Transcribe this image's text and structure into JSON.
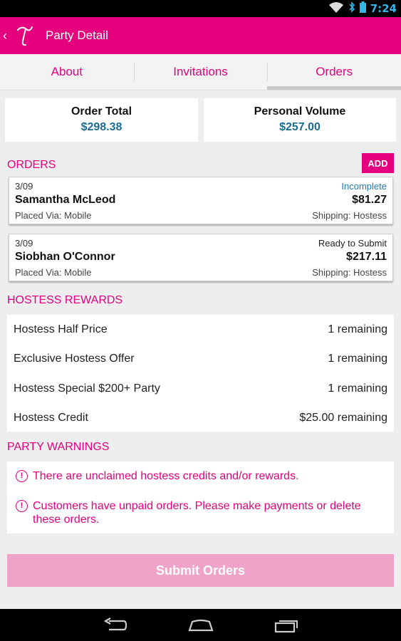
{
  "status_bar": {
    "time": "7:24",
    "icons": [
      "wifi-icon",
      "bluetooth-icon",
      "battery-icon"
    ]
  },
  "action_bar": {
    "title": "Party Detail",
    "back_icon": "chevron-left-icon",
    "logo_icon": "app-logo-icon"
  },
  "tabs": [
    {
      "label": "About",
      "active": false
    },
    {
      "label": "Invitations",
      "active": false
    },
    {
      "label": "Orders",
      "active": true
    }
  ],
  "summary": {
    "order_total_label": "Order Total",
    "order_total_value": "$298.38",
    "personal_volume_label": "Personal Volume",
    "personal_volume_value": "$257.00"
  },
  "orders": {
    "section_title": "ORDERS",
    "add_label": "ADD",
    "items": [
      {
        "date": "3/09",
        "status": "Incomplete",
        "status_color": "#1a7cb0",
        "name": "Samantha McLeod",
        "amount": "$81.27",
        "placed_via": "Placed Via: Mobile",
        "shipping": "Shipping: Hostess"
      },
      {
        "date": "3/09",
        "status": "Ready to Submit",
        "status_color": "#222222",
        "name": "Siobhan O'Connor",
        "amount": "$217.11",
        "placed_via": "Placed Via: Mobile",
        "shipping": "Shipping: Hostess"
      }
    ]
  },
  "hostess_rewards": {
    "section_title": "HOSTESS REWARDS",
    "items": [
      {
        "label": "Hostess Half Price",
        "value": "1 remaining"
      },
      {
        "label": "Exclusive Hostess Offer",
        "value": "1 remaining"
      },
      {
        "label": "Hostess Special $200+ Party",
        "value": "1 remaining"
      },
      {
        "label": "Hostess Credit",
        "value": "$25.00 remaining"
      }
    ]
  },
  "party_warnings": {
    "section_title": "PARTY WARNINGS",
    "icon": "exclamation-circle-icon",
    "items": [
      {
        "text": "There are unclaimed hostess credits and/or rewards."
      },
      {
        "text": "Customers have unpaid orders. Please make payments or delete these orders."
      }
    ]
  },
  "submit_label": "Submit Orders",
  "colors": {
    "brand": "#e5007e",
    "value_blue": "#1a6b92",
    "submit_disabled": "#efa3c9"
  },
  "nav_bar": {
    "icons": [
      "back-nav-icon",
      "home-nav-icon",
      "recents-nav-icon"
    ]
  }
}
